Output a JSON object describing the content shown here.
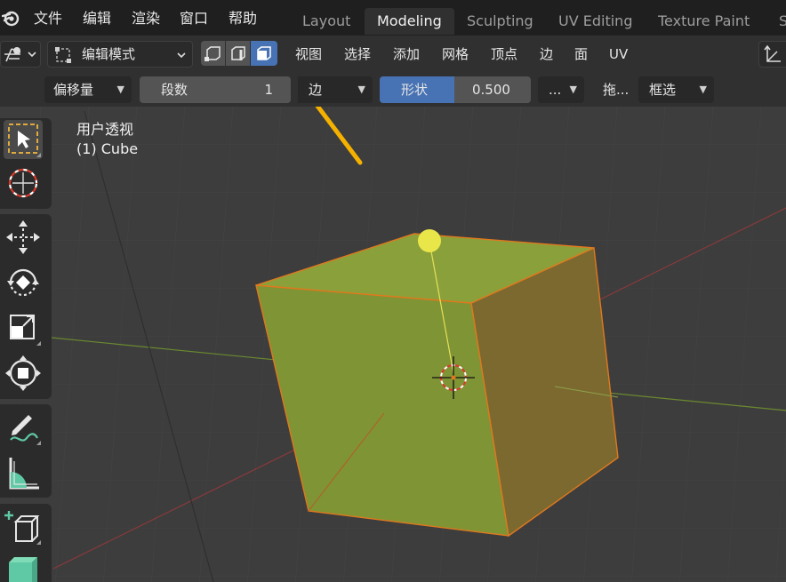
{
  "topbar": {
    "menus": [
      "文件",
      "编辑",
      "渲染",
      "窗口",
      "帮助"
    ],
    "tabs": [
      "Layout",
      "Modeling",
      "Sculpting",
      "UV Editing",
      "Texture Paint",
      "S"
    ]
  },
  "header": {
    "mode": "编辑模式",
    "menus": [
      "视图",
      "选择",
      "添加",
      "网格",
      "顶点",
      "边",
      "面",
      "UV"
    ],
    "select_mode_active": "face"
  },
  "tool_settings": {
    "width_type": "偏移量",
    "segments_label": "段数",
    "segments_value": "1",
    "affect": "边",
    "profile_label": "形状",
    "profile_value": "0.500",
    "more": "...",
    "drag_label": "拖...",
    "select_box": "框选"
  },
  "viewport": {
    "view_name": "用户透视",
    "object_name": "(1) Cube"
  },
  "colors": {
    "accent": "#4772b3",
    "face_select": "#8a9a36",
    "arrow": "#f5b100"
  },
  "toolbar_icons": [
    "select-box-icon",
    "cursor-icon",
    "move-icon",
    "rotate-icon",
    "scale-icon",
    "transform-icon",
    "annotate-icon",
    "measure-icon",
    "add-cube-icon",
    "extrude-icon"
  ]
}
